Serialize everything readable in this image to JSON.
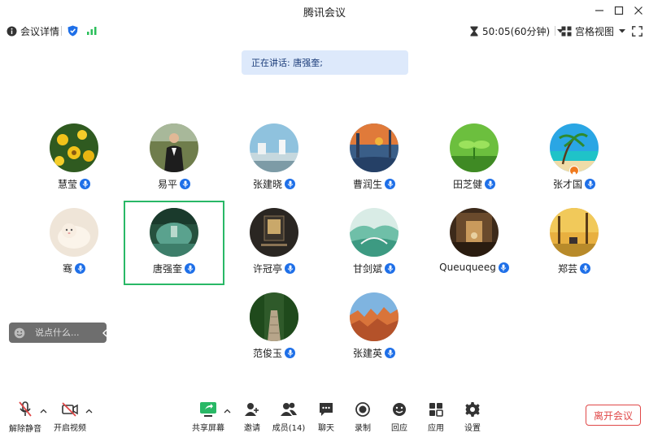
{
  "window": {
    "title": "腾讯会议"
  },
  "toolbar": {
    "meeting_info": "会议详情",
    "timer": "50:05(60分钟)",
    "view_mode": "宫格视图"
  },
  "speaking": {
    "label": "正在讲话: 唐强奎;"
  },
  "participants": [
    {
      "name": "慧莹"
    },
    {
      "name": "易平"
    },
    {
      "name": "张建晓"
    },
    {
      "name": "曹润生"
    },
    {
      "name": "田芝健"
    },
    {
      "name": "张才国"
    },
    {
      "name": "骞"
    },
    {
      "name": "唐强奎"
    },
    {
      "name": "许冠亭"
    },
    {
      "name": "甘剑斌"
    },
    {
      "name": "Queuqueeg"
    },
    {
      "name": "郑芸"
    },
    {
      "name": "范俊玉"
    },
    {
      "name": "张建英"
    }
  ],
  "chat": {
    "placeholder": "说点什么..."
  },
  "bottom": {
    "unmute": "解除静音",
    "start_video": "开启视频",
    "share_screen": "共享屏幕",
    "invite": "邀请",
    "members": "成员(14)",
    "chat": "聊天",
    "record": "录制",
    "reactions": "回应",
    "apps": "应用",
    "settings": "设置",
    "leave": "离开会议"
  },
  "colors": {
    "accent_blue": "#1e6fe8",
    "active_speaker_border": "#29b866",
    "leave_red": "#e04848",
    "signal_green": "#2bbf5b",
    "speaking_bg": "#dde9fb"
  }
}
